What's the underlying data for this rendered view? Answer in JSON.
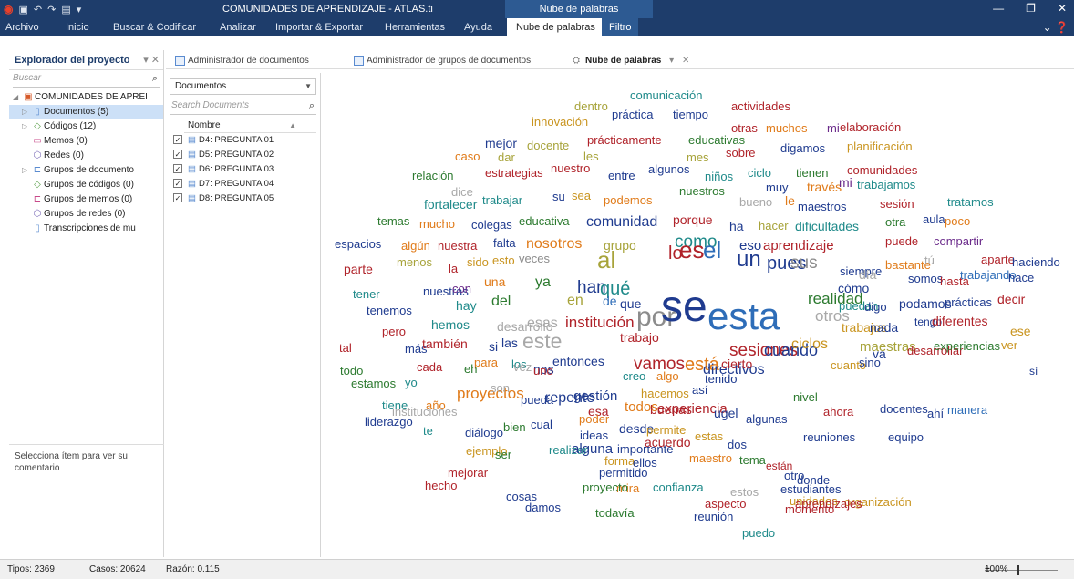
{
  "window": {
    "title": "COMUNIDADES DE APRENDIZAJE - ATLAS.ti",
    "context_title": "Nube de palabras"
  },
  "ribbon": {
    "tabs": [
      {
        "label": "Archivo"
      },
      {
        "label": "Inicio"
      },
      {
        "label": "Buscar & Codificar"
      },
      {
        "label": "Analizar"
      },
      {
        "label": "Importar & Exportar"
      },
      {
        "label": "Herramientas"
      },
      {
        "label": "Ayuda"
      },
      {
        "label": "Nube de palabras"
      },
      {
        "label": "Filtro"
      }
    ]
  },
  "explorer": {
    "title": "Explorador del proyecto",
    "search_placeholder": "Buscar",
    "tree": [
      {
        "label": "COMUNIDADES DE APREI",
        "icon": "project-icon"
      },
      {
        "label": "Documentos (5)",
        "icon": "document-icon"
      },
      {
        "label": "Códigos (12)",
        "icon": "code-icon"
      },
      {
        "label": "Memos (0)",
        "icon": "memo-icon"
      },
      {
        "label": "Redes (0)",
        "icon": "network-icon"
      },
      {
        "label": "Grupos de documento",
        "icon": "document-group-icon"
      },
      {
        "label": "Grupos de códigos (0)",
        "icon": "code-group-icon"
      },
      {
        "label": "Grupos de memos (0)",
        "icon": "memo-group-icon"
      },
      {
        "label": "Grupos de redes (0)",
        "icon": "network-group-icon"
      },
      {
        "label": "Transcripciones de mu",
        "icon": "transcript-icon"
      }
    ],
    "comment_hint": "Selecciona ítem para ver su comentario"
  },
  "tabs": [
    {
      "label": "Administrador de documentos"
    },
    {
      "label": "Administrador de grupos de documentos"
    },
    {
      "label": "Nube de palabras"
    }
  ],
  "docmgr": {
    "filter_value": "Documentos",
    "search_placeholder": "Search Documents",
    "column_name": "Nombre",
    "docs": [
      {
        "label": "D4: PREGUNTA 01",
        "checked": "✓"
      },
      {
        "label": "D5: PREGUNTA 02",
        "checked": "✓"
      },
      {
        "label": "D6: PREGUNTA 03",
        "checked": "✓"
      },
      {
        "label": "D7: PREGUNTA 04",
        "checked": "✓"
      },
      {
        "label": "D8: PREGUNTA 05",
        "checked": "✓"
      }
    ]
  },
  "colors": {
    "navy": "#1f3b8f",
    "teal": "#1f8a8a",
    "orange": "#e07b1a",
    "olive": "#a7a33a",
    "red": "#b0232a",
    "green": "#2c7a2f",
    "gold": "#c9941f",
    "gray": "#8c8c8c",
    "purple": "#6a2a8a",
    "blue": "#2e6db8",
    "lightgray": "#a8a8a8"
  },
  "cloud_words": [
    {
      "w": "comunicación",
      "c": "teal"
    },
    {
      "w": "dentro",
      "c": "olive"
    },
    {
      "w": "práctica",
      "c": "navy"
    },
    {
      "w": "tiempo",
      "c": "navy"
    },
    {
      "w": "actividades",
      "c": "red"
    },
    {
      "w": "innovación",
      "c": "gold"
    },
    {
      "w": "otras",
      "c": "red"
    },
    {
      "w": "muchos",
      "c": "orange"
    },
    {
      "w": "mi",
      "c": "purple"
    },
    {
      "w": "elaboración",
      "c": "red"
    },
    {
      "w": "mejor",
      "c": "navy"
    },
    {
      "w": "docente",
      "c": "olive"
    },
    {
      "w": "prácticamente",
      "c": "red"
    },
    {
      "w": "educativas",
      "c": "green"
    },
    {
      "w": "caso",
      "c": "orange"
    },
    {
      "w": "dar",
      "c": "olive"
    },
    {
      "w": "les",
      "c": "olive"
    },
    {
      "w": "mes",
      "c": "olive"
    },
    {
      "w": "sobre",
      "c": "red"
    },
    {
      "w": "digamos",
      "c": "navy"
    },
    {
      "w": "planificación",
      "c": "gold"
    },
    {
      "w": "relación",
      "c": "green"
    },
    {
      "w": "estrategias",
      "c": "red"
    },
    {
      "w": "nuestro",
      "c": "red"
    },
    {
      "w": "entre",
      "c": "navy"
    },
    {
      "w": "algunos",
      "c": "navy"
    },
    {
      "w": "niños",
      "c": "teal"
    },
    {
      "w": "ciclo",
      "c": "teal"
    },
    {
      "w": "tienen",
      "c": "green"
    },
    {
      "w": "comunidades",
      "c": "red"
    },
    {
      "w": "dice",
      "c": "lightgray"
    },
    {
      "w": "muy",
      "c": "navy"
    },
    {
      "w": "través",
      "c": "orange"
    },
    {
      "w": "mi",
      "c": "purple"
    },
    {
      "w": "trabajamos",
      "c": "teal"
    },
    {
      "w": "fortalecer",
      "c": "teal"
    },
    {
      "w": "trabajar",
      "c": "teal"
    },
    {
      "w": "su",
      "c": "navy"
    },
    {
      "w": "sea",
      "c": "gold"
    },
    {
      "w": "podemos",
      "c": "orange"
    },
    {
      "w": "nuestros",
      "c": "green"
    },
    {
      "w": "bueno",
      "c": "lightgray"
    },
    {
      "w": "le",
      "c": "orange"
    },
    {
      "w": "maestros",
      "c": "navy"
    },
    {
      "w": "sesión",
      "c": "red"
    },
    {
      "w": "tratamos",
      "c": "teal"
    },
    {
      "w": "temas",
      "c": "green"
    },
    {
      "w": "mucho",
      "c": "orange"
    },
    {
      "w": "colegas",
      "c": "navy"
    },
    {
      "w": "educativa",
      "c": "green"
    },
    {
      "w": "comunidad",
      "c": "navy"
    },
    {
      "w": "porque",
      "c": "red"
    },
    {
      "w": "ha",
      "c": "navy"
    },
    {
      "w": "hacer",
      "c": "olive"
    },
    {
      "w": "dificultades",
      "c": "teal"
    },
    {
      "w": "otra",
      "c": "green"
    },
    {
      "w": "aula",
      "c": "navy"
    },
    {
      "w": "poco",
      "c": "orange"
    },
    {
      "w": "espacios",
      "c": "navy"
    },
    {
      "w": "algún",
      "c": "orange"
    },
    {
      "w": "nuestra",
      "c": "red"
    },
    {
      "w": "falta",
      "c": "navy"
    },
    {
      "w": "nosotros",
      "c": "orange"
    },
    {
      "w": "grupo",
      "c": "olive"
    },
    {
      "w": "como",
      "c": "teal"
    },
    {
      "w": "eso",
      "c": "navy"
    },
    {
      "w": "aprendizaje",
      "c": "red"
    },
    {
      "w": "puede",
      "c": "red"
    },
    {
      "w": "compartir",
      "c": "purple"
    },
    {
      "w": "menos",
      "c": "olive"
    },
    {
      "w": "sido",
      "c": "gold"
    },
    {
      "w": "esto",
      "c": "gold"
    },
    {
      "w": "veces",
      "c": "gray"
    },
    {
      "w": "bastante",
      "c": "orange"
    },
    {
      "w": "tú",
      "c": "lightgray"
    },
    {
      "w": "aparte",
      "c": "red"
    },
    {
      "w": "haciendo",
      "c": "navy"
    },
    {
      "w": "parte",
      "c": "red"
    },
    {
      "w": "la",
      "c": "red"
    },
    {
      "w": "al",
      "c": "olive"
    },
    {
      "w": "lo",
      "c": "red"
    },
    {
      "w": "es",
      "c": "red"
    },
    {
      "w": "el",
      "c": "blue"
    },
    {
      "w": "un",
      "c": "navy"
    },
    {
      "w": "pues",
      "c": "navy"
    },
    {
      "w": "sus",
      "c": "gray"
    },
    {
      "w": "siempre",
      "c": "navy"
    },
    {
      "w": "día",
      "c": "lightgray"
    },
    {
      "w": "somos",
      "c": "navy"
    },
    {
      "w": "hasta",
      "c": "red"
    },
    {
      "w": "trabajando",
      "c": "blue"
    },
    {
      "w": "hace",
      "c": "navy"
    },
    {
      "w": "tener",
      "c": "teal"
    },
    {
      "w": "nuestras",
      "c": "navy"
    },
    {
      "w": "con",
      "c": "purple"
    },
    {
      "w": "una",
      "c": "orange"
    },
    {
      "w": "ya",
      "c": "green"
    },
    {
      "w": "han",
      "c": "navy"
    },
    {
      "w": "qué",
      "c": "teal"
    },
    {
      "w": "cómo",
      "c": "navy"
    },
    {
      "w": "puedan",
      "c": "teal"
    },
    {
      "w": "digo",
      "c": "navy"
    },
    {
      "w": "podamos",
      "c": "navy"
    },
    {
      "w": "prácticas",
      "c": "navy"
    },
    {
      "w": "decir",
      "c": "red"
    },
    {
      "w": "tenemos",
      "c": "navy"
    },
    {
      "w": "hay",
      "c": "teal"
    },
    {
      "w": "del",
      "c": "green"
    },
    {
      "w": "en",
      "c": "olive"
    },
    {
      "w": "de",
      "c": "blue"
    },
    {
      "w": "que",
      "c": "navy"
    },
    {
      "w": "por",
      "c": "gray"
    },
    {
      "w": "se",
      "c": "navy"
    },
    {
      "w": "esta",
      "c": "blue"
    },
    {
      "w": "realidad",
      "c": "green"
    },
    {
      "w": "otros",
      "c": "lightgray"
    },
    {
      "w": "trabajos",
      "c": "gold"
    },
    {
      "w": "nada",
      "c": "navy"
    },
    {
      "w": "tengo",
      "c": "navy"
    },
    {
      "w": "diferentes",
      "c": "red"
    },
    {
      "w": "ese",
      "c": "gold"
    },
    {
      "w": "pero",
      "c": "red"
    },
    {
      "w": "hemos",
      "c": "teal"
    },
    {
      "w": "desarrollo",
      "c": "lightgray"
    },
    {
      "w": "esas",
      "c": "lightgray"
    },
    {
      "w": "institución",
      "c": "red"
    },
    {
      "w": "tal",
      "c": "red"
    },
    {
      "w": "más",
      "c": "navy"
    },
    {
      "w": "también",
      "c": "red"
    },
    {
      "w": "si",
      "c": "navy"
    },
    {
      "w": "las",
      "c": "navy"
    },
    {
      "w": "este",
      "c": "lightgray"
    },
    {
      "w": "trabajo",
      "c": "red"
    },
    {
      "w": "sesiones",
      "c": "red"
    },
    {
      "w": "cuando",
      "c": "navy"
    },
    {
      "w": "ciclos",
      "c": "gold"
    },
    {
      "w": "maestras",
      "c": "olive"
    },
    {
      "w": "desarrollar",
      "c": "red"
    },
    {
      "w": "experiencias",
      "c": "green"
    },
    {
      "w": "ver",
      "c": "gold"
    },
    {
      "w": "sí",
      "c": "navy"
    },
    {
      "w": "todo",
      "c": "green"
    },
    {
      "w": "cada",
      "c": "red"
    },
    {
      "w": "para",
      "c": "orange"
    },
    {
      "w": "los",
      "c": "teal"
    },
    {
      "w": "nos",
      "c": "navy"
    },
    {
      "w": "entonces",
      "c": "navy"
    },
    {
      "w": "vamos",
      "c": "red"
    },
    {
      "w": "está",
      "c": "orange"
    },
    {
      "w": "directivos",
      "c": "navy"
    },
    {
      "w": "cierto",
      "c": "red"
    },
    {
      "w": "tenido",
      "c": "navy"
    },
    {
      "w": "cuanto",
      "c": "gold"
    },
    {
      "w": "va",
      "c": "navy"
    },
    {
      "w": "sino",
      "c": "navy"
    },
    {
      "w": "estamos",
      "c": "green"
    },
    {
      "w": "yo",
      "c": "teal"
    },
    {
      "w": "eh",
      "c": "green"
    },
    {
      "w": "vez",
      "c": "lightgray"
    },
    {
      "w": "uno",
      "c": "red"
    },
    {
      "w": "creo",
      "c": "teal"
    },
    {
      "w": "algo",
      "c": "orange"
    },
    {
      "w": "así",
      "c": "navy"
    },
    {
      "w": "nivel",
      "c": "green"
    },
    {
      "w": "tiene",
      "c": "teal"
    },
    {
      "w": "año",
      "c": "orange"
    },
    {
      "w": "proyectos",
      "c": "orange"
    },
    {
      "w": "pueda",
      "c": "navy"
    },
    {
      "w": "gestión",
      "c": "navy"
    },
    {
      "w": "esa",
      "c": "red"
    },
    {
      "w": "hacemos",
      "c": "gold"
    },
    {
      "w": "buenas",
      "c": "red"
    },
    {
      "w": "liderazgo",
      "c": "navy"
    },
    {
      "w": "instituciones",
      "c": "lightgray"
    },
    {
      "w": "son",
      "c": "lightgray"
    },
    {
      "w": "repente",
      "c": "navy"
    },
    {
      "w": "poder",
      "c": "orange"
    },
    {
      "w": "todos",
      "c": "orange"
    },
    {
      "w": "experiencia",
      "c": "red"
    },
    {
      "w": "ugel",
      "c": "navy"
    },
    {
      "w": "algunas",
      "c": "navy"
    },
    {
      "w": "ahora",
      "c": "red"
    },
    {
      "w": "docentes",
      "c": "navy"
    },
    {
      "w": "ahí",
      "c": "navy"
    },
    {
      "w": "manera",
      "c": "blue"
    },
    {
      "w": "te",
      "c": "teal"
    },
    {
      "w": "diálogo",
      "c": "navy"
    },
    {
      "w": "bien",
      "c": "green"
    },
    {
      "w": "cual",
      "c": "navy"
    },
    {
      "w": "ideas",
      "c": "navy"
    },
    {
      "w": "desde",
      "c": "navy"
    },
    {
      "w": "permite",
      "c": "gold"
    },
    {
      "w": "estas",
      "c": "gold"
    },
    {
      "w": "dos",
      "c": "navy"
    },
    {
      "w": "reuniones",
      "c": "navy"
    },
    {
      "w": "equipo",
      "c": "navy"
    },
    {
      "w": "ejemplo",
      "c": "gold"
    },
    {
      "w": "ser",
      "c": "green"
    },
    {
      "w": "realizar",
      "c": "teal"
    },
    {
      "w": "importante",
      "c": "navy"
    },
    {
      "w": "acuerdo",
      "c": "red"
    },
    {
      "w": "maestro",
      "c": "orange"
    },
    {
      "w": "tema",
      "c": "green"
    },
    {
      "w": "mejorar",
      "c": "red"
    },
    {
      "w": "alguna",
      "c": "navy"
    },
    {
      "w": "forma",
      "c": "gold"
    },
    {
      "w": "permitido",
      "c": "navy"
    },
    {
      "w": "ellos",
      "c": "navy"
    },
    {
      "w": "están",
      "c": "red"
    },
    {
      "w": "donde",
      "c": "navy"
    },
    {
      "w": "otro",
      "c": "navy"
    },
    {
      "w": "estudiantes",
      "c": "navy"
    },
    {
      "w": "hecho",
      "c": "red"
    },
    {
      "w": "mira",
      "c": "orange"
    },
    {
      "w": "estos",
      "c": "lightgray"
    },
    {
      "w": "cosas",
      "c": "navy"
    },
    {
      "w": "proyecto",
      "c": "green"
    },
    {
      "w": "confianza",
      "c": "teal"
    },
    {
      "w": "unidades",
      "c": "gold"
    },
    {
      "w": "organización",
      "c": "gold"
    },
    {
      "w": "aprendizajes",
      "c": "red"
    },
    {
      "w": "aspecto",
      "c": "red"
    },
    {
      "w": "momento",
      "c": "red"
    },
    {
      "w": "damos",
      "c": "navy"
    },
    {
      "w": "todavía",
      "c": "green"
    },
    {
      "w": "reunión",
      "c": "navy"
    },
    {
      "w": "puedo",
      "c": "teal"
    }
  ],
  "status": {
    "tipos": "Tipos: 2369",
    "casos": "Casos: 20624",
    "razon": "Razón: 0.115",
    "zoom_minus": "−",
    "zoom_plus": "+",
    "zoom_level": "100%"
  }
}
